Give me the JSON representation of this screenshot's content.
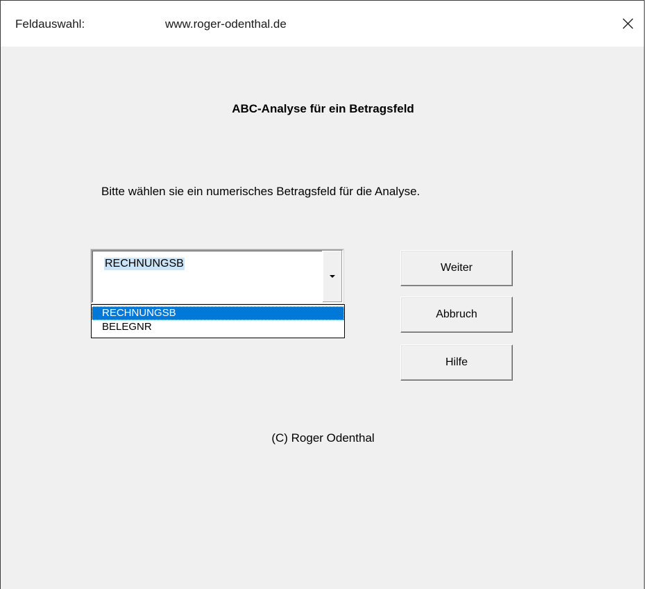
{
  "window": {
    "title": "Feldauswahl:",
    "url": "www.roger-odenthal.de"
  },
  "dialog": {
    "heading": "ABC-Analyse für ein Betragsfeld",
    "instruction": "Bitte wählen sie ein numerisches Betragsfeld für die Analyse.",
    "copyright": "(C) Roger Odenthal"
  },
  "combo": {
    "selected_value": "RECHNUNGSB",
    "options": [
      "RECHNUNGSB",
      "BELEGNR"
    ]
  },
  "buttons": {
    "weiter": "Weiter",
    "abbruch": "Abbruch",
    "hilfe": "Hilfe"
  },
  "colors": {
    "dialog_bg": "#f0f0f0",
    "selection": "#0078d7"
  },
  "icons": {
    "close": "close-icon",
    "dropdown": "chevron-down-icon"
  }
}
